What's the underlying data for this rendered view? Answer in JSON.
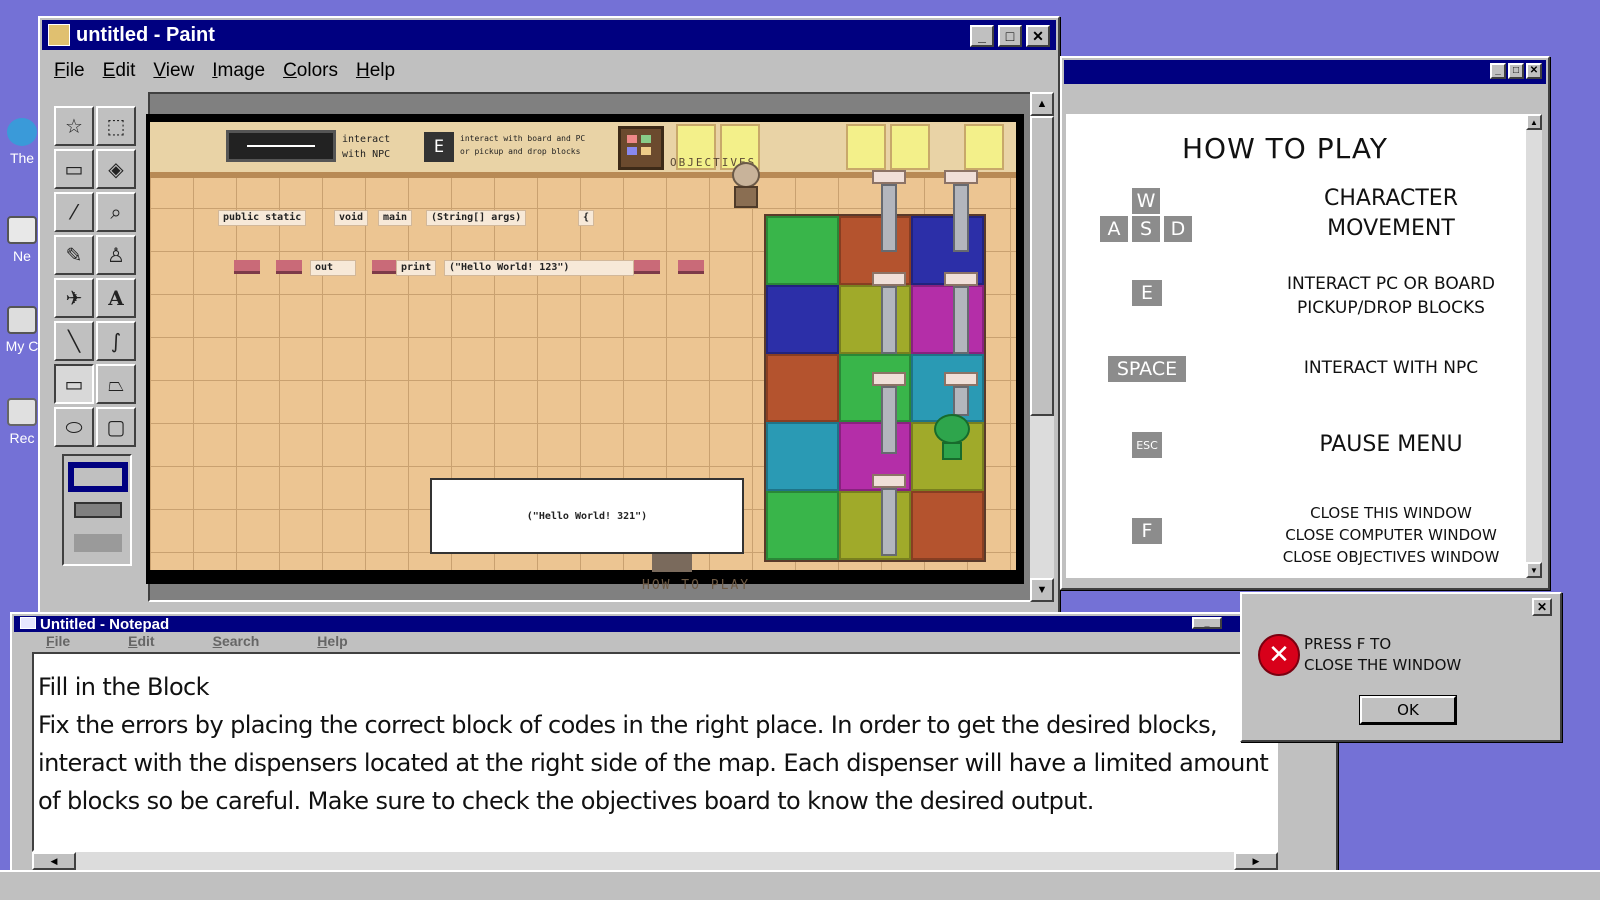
{
  "desktop": {
    "icons": [
      {
        "label": "The",
        "icon": "globe-icon"
      },
      {
        "label": "Ne",
        "icon": "network-icon"
      },
      {
        "label": "My C",
        "icon": "my-computer-icon"
      },
      {
        "label": "Rec",
        "icon": "recycle-bin-icon"
      }
    ],
    "background_color": "#7471d6"
  },
  "paint": {
    "title": "untitled - Paint",
    "menu": [
      "File",
      "Edit",
      "View",
      "Image",
      "Colors",
      "Help"
    ],
    "tools": [
      "free-select",
      "rect-select",
      "eraser",
      "fill",
      "eyedropper",
      "magnifier",
      "pencil",
      "brush",
      "airbrush",
      "text",
      "line",
      "curve",
      "rectangle",
      "polygon",
      "ellipse",
      "rounded-rectangle"
    ],
    "game": {
      "hud_interact_npc": "interact\nwith NPC",
      "hud_key": "E",
      "hud_interact_board": "interact with board and PC\nor pickup and drop blocks",
      "objectives_label": "OBJECTIVES",
      "code_line1": [
        "public static",
        "void",
        "main",
        "(String[] args)",
        "{"
      ],
      "code_line2": [
        "out",
        "print",
        "(\"Hello World! 123\")"
      ],
      "dialog_text": "(\"Hello World! 321\")",
      "how_to_play_label": "HOW TO PLAY"
    }
  },
  "howto": {
    "title": "HOW TO PLAY",
    "rows": [
      {
        "keys": [
          "W",
          "A",
          "S",
          "D"
        ],
        "action": "CHARACTER\nMOVEMENT"
      },
      {
        "keys": [
          "E"
        ],
        "action": "INTERACT PC OR BOARD\nPICKUP/DROP BLOCKS"
      },
      {
        "keys": [
          "SPACE"
        ],
        "action": "INTERACT WITH NPC"
      },
      {
        "keys": [
          "ESC"
        ],
        "action": "PAUSE MENU"
      },
      {
        "keys": [
          "F"
        ],
        "action": "CLOSE THIS WINDOW\nCLOSE COMPUTER WINDOW\nCLOSE OBJECTIVES WINDOW"
      }
    ]
  },
  "notepad": {
    "title": "Untitled - Notepad",
    "menu": [
      "File",
      "Edit",
      "Search",
      "Help"
    ],
    "heading": "Fill in the Block",
    "body": "Fix the errors by placing the correct block of codes in the right place. In order to get the desired blocks, interact with the dispensers located at the right side of the map. Each dispenser will have a limited amount of blocks so be careful. Make sure to check the objectives board to know the desired output."
  },
  "error_dialog": {
    "message": "PRESS F TO\nCLOSE THE WINDOW",
    "ok_label": "OK"
  },
  "colors": {
    "title_bar": "#000080",
    "window_face": "#c0c0c0",
    "error_red": "#d8001a"
  }
}
